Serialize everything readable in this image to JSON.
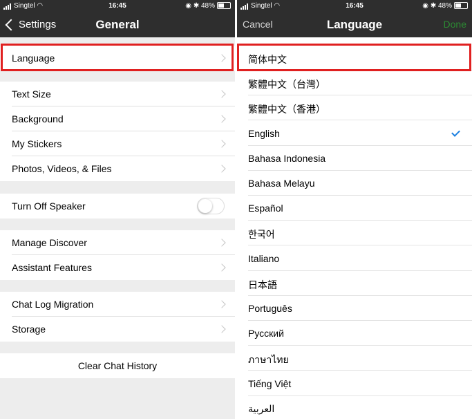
{
  "status_bar": {
    "carrier": "Singtel",
    "time": "16:45",
    "battery": "48%"
  },
  "left": {
    "nav": {
      "back_label": "Settings",
      "title": "General"
    },
    "rows": {
      "language": "Language",
      "text_size": "Text Size",
      "background": "Background",
      "my_stickers": "My Stickers",
      "photos": "Photos, Videos, & Files",
      "turn_off_speaker": "Turn Off Speaker",
      "manage_discover": "Manage Discover",
      "assistant_features": "Assistant Features",
      "chat_log_migration": "Chat Log Migration",
      "storage": "Storage",
      "clear_chat_history": "Clear Chat History"
    },
    "turn_off_speaker_on": false
  },
  "right": {
    "nav": {
      "cancel_label": "Cancel",
      "title": "Language",
      "done_label": "Done"
    },
    "languages": [
      "简体中文",
      "繁體中文（台灣）",
      "繁體中文（香港）",
      "English",
      "Bahasa Indonesia",
      "Bahasa Melayu",
      "Español",
      "한국어",
      "Italiano",
      "日本語",
      "Português",
      "Русский",
      "ภาษาไทย",
      "Tiếng Việt",
      "العربية"
    ],
    "selected": "English"
  },
  "colors": {
    "nav_bar": "#2e2e2e",
    "highlight": "#e02020",
    "check": "#1b7fe0",
    "done": "#2c8a33"
  }
}
